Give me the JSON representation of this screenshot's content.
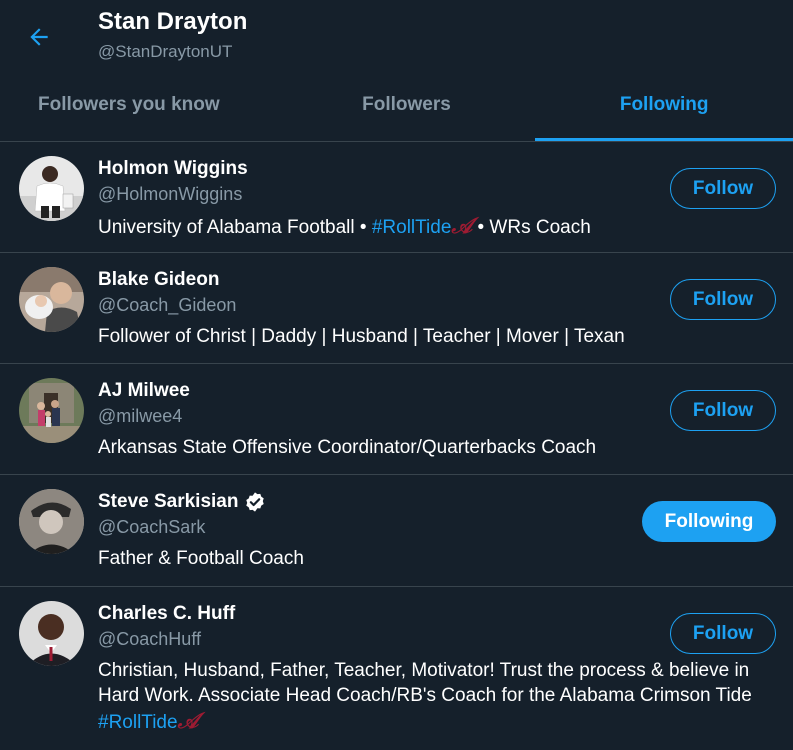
{
  "header": {
    "name": "Stan Drayton",
    "handle": "@StanDraytonUT"
  },
  "tabs": [
    {
      "label": "Followers you know",
      "active": false
    },
    {
      "label": "Followers",
      "active": false
    },
    {
      "label": "Following",
      "active": true
    }
  ],
  "users": [
    {
      "name": "Holmon Wiggins",
      "handle": "@HolmonWiggins",
      "bio_parts": [
        "University of Alabama Football • ",
        "#RollTide",
        "𝒜",
        " • WRs Coach"
      ],
      "button": "Follow",
      "verified": false
    },
    {
      "name": "Blake Gideon",
      "handle": "@Coach_Gideon",
      "bio": "Follower of Christ | Daddy | Husband | Teacher | Mover | Texan",
      "button": "Follow",
      "verified": false
    },
    {
      "name": "AJ Milwee",
      "handle": "@milwee4",
      "bio": "Arkansas State Offensive Coordinator/Quarterbacks Coach",
      "button": "Follow",
      "verified": false
    },
    {
      "name": "Steve Sarkisian",
      "handle": "@CoachSark",
      "bio": "Father & Football Coach",
      "button": "Following",
      "verified": true
    },
    {
      "name": "Charles C. Huff",
      "handle": "@CoachHuff",
      "bio_parts": [
        "Christian, Husband, Father, Teacher, Motivator! Trust the process & believe in Hard Work. Associate Head Coach/RB's Coach for the Alabama Crimson Tide ",
        "#RollTide",
        "𝒜"
      ],
      "button": "Follow",
      "verified": false
    }
  ],
  "colors": {
    "background": "#15202b",
    "accent": "#1da1f2",
    "secondary_text": "#8899a6",
    "divider": "#38444d",
    "crimson": "#9e1b32"
  }
}
